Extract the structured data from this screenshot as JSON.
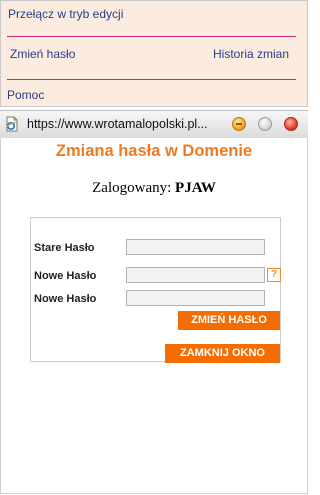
{
  "top_menu": {
    "edit_mode": "Przełącz w tryb edycji",
    "change_password": "Zmień hasło",
    "history": "Historia zmian",
    "help": "Pomoc"
  },
  "popup": {
    "url": "https://www.wrotamalopolski.pl...",
    "title": "Zmiana hasła w Domenie",
    "logged_prefix": "Zalogowany:",
    "logged_user": "PJAW",
    "form": {
      "old_password_label": "Stare Hasło",
      "new_password_label": "Nowe Hasło",
      "repeat_password_label": "Nowe Hasło",
      "help_glyph": "?",
      "change_button": "ZMIEŃ HASŁO",
      "close_button": "ZAMKNIJ OKNO"
    }
  },
  "colors": {
    "accent_orange": "#f56c00",
    "title_orange": "#f27a1d",
    "panel_bg": "#fcebdf",
    "separator_magenta": "#c8287a",
    "link_blue": "#283e86"
  },
  "icons": {
    "page": "ie-page-icon",
    "minimize": "minimize-icon",
    "maximize": "maximize-icon",
    "close": "close-icon"
  }
}
